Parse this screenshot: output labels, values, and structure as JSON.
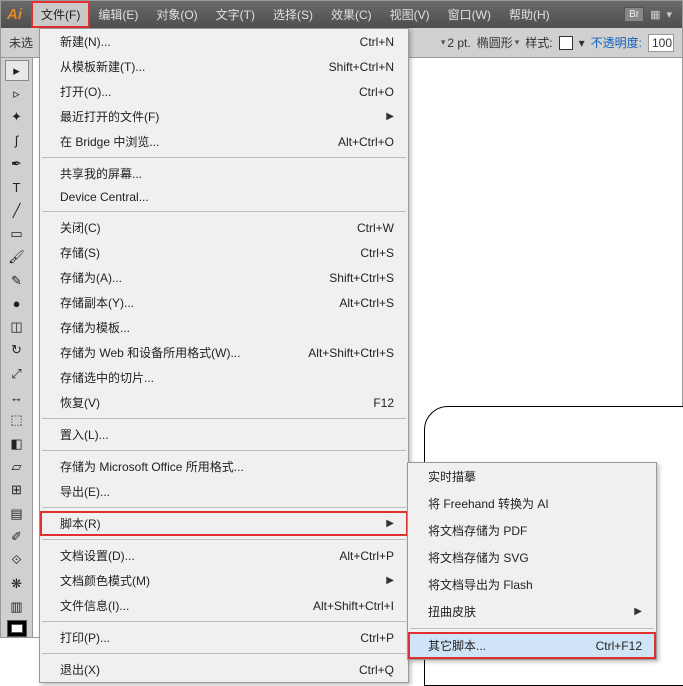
{
  "app": {
    "logo": "Ai"
  },
  "menubar": {
    "items": [
      {
        "label": "文件(F)",
        "active": true
      },
      {
        "label": "编辑(E)"
      },
      {
        "label": "对象(O)"
      },
      {
        "label": "文字(T)"
      },
      {
        "label": "选择(S)"
      },
      {
        "label": "效果(C)"
      },
      {
        "label": "视图(V)"
      },
      {
        "label": "窗口(W)"
      },
      {
        "label": "帮助(H)"
      }
    ]
  },
  "topright": {
    "br_label": "Br",
    "grid_icon": "▦",
    "down_icon": "▾"
  },
  "toolbar": {
    "prefix": "未选",
    "stroke_value": "2 pt.",
    "brush_name": "椭圆形",
    "style_label": "样式:",
    "opacity_label": "不透明度:",
    "opacity_value": "100"
  },
  "tools": [
    {
      "name": "selection-tool",
      "glyph": "▸"
    },
    {
      "name": "direct-select-tool",
      "glyph": "▹"
    },
    {
      "name": "magic-wand-tool",
      "glyph": "✦"
    },
    {
      "name": "lasso-tool",
      "glyph": "ʃ"
    },
    {
      "name": "pen-tool",
      "glyph": "✒"
    },
    {
      "name": "type-tool",
      "glyph": "T"
    },
    {
      "name": "line-tool",
      "glyph": "╱"
    },
    {
      "name": "rectangle-tool",
      "glyph": "▭"
    },
    {
      "name": "paintbrush-tool",
      "glyph": "🖌"
    },
    {
      "name": "pencil-tool",
      "glyph": "✎"
    },
    {
      "name": "blob-brush-tool",
      "glyph": "●"
    },
    {
      "name": "eraser-tool",
      "glyph": "◫"
    },
    {
      "name": "rotate-tool",
      "glyph": "↻"
    },
    {
      "name": "scale-tool",
      "glyph": "⤢"
    },
    {
      "name": "width-tool",
      "glyph": "↔"
    },
    {
      "name": "free-transform-tool",
      "glyph": "⬚"
    },
    {
      "name": "shape-builder-tool",
      "glyph": "◧"
    },
    {
      "name": "perspective-tool",
      "glyph": "▱"
    },
    {
      "name": "mesh-tool",
      "glyph": "⊞"
    },
    {
      "name": "gradient-tool",
      "glyph": "▤"
    },
    {
      "name": "eyedropper-tool",
      "glyph": "✐"
    },
    {
      "name": "blend-tool",
      "glyph": "⟐"
    },
    {
      "name": "symbol-sprayer-tool",
      "glyph": "❋"
    },
    {
      "name": "column-graph-tool",
      "glyph": "▥"
    }
  ],
  "file_menu": [
    {
      "type": "item",
      "label": "新建(N)...",
      "shortcut": "Ctrl+N"
    },
    {
      "type": "item",
      "label": "从模板新建(T)...",
      "shortcut": "Shift+Ctrl+N"
    },
    {
      "type": "item",
      "label": "打开(O)...",
      "shortcut": "Ctrl+O"
    },
    {
      "type": "item",
      "label": "最近打开的文件(F)",
      "arrow": true
    },
    {
      "type": "item",
      "label": "在 Bridge 中浏览...",
      "shortcut": "Alt+Ctrl+O"
    },
    {
      "type": "sep"
    },
    {
      "type": "item",
      "label": "共享我的屏幕..."
    },
    {
      "type": "item",
      "label": "Device Central..."
    },
    {
      "type": "sep"
    },
    {
      "type": "item",
      "label": "关闭(C)",
      "shortcut": "Ctrl+W"
    },
    {
      "type": "item",
      "label": "存储(S)",
      "shortcut": "Ctrl+S"
    },
    {
      "type": "item",
      "label": "存储为(A)...",
      "shortcut": "Shift+Ctrl+S"
    },
    {
      "type": "item",
      "label": "存储副本(Y)...",
      "shortcut": "Alt+Ctrl+S"
    },
    {
      "type": "item",
      "label": "存储为模板..."
    },
    {
      "type": "item",
      "label": "存储为 Web 和设备所用格式(W)...",
      "shortcut": "Alt+Shift+Ctrl+S"
    },
    {
      "type": "item",
      "label": "存储选中的切片..."
    },
    {
      "type": "item",
      "label": "恢复(V)",
      "shortcut": "F12"
    },
    {
      "type": "sep"
    },
    {
      "type": "item",
      "label": "置入(L)..."
    },
    {
      "type": "sep"
    },
    {
      "type": "item",
      "label": "存储为 Microsoft Office 所用格式..."
    },
    {
      "type": "item",
      "label": "导出(E)..."
    },
    {
      "type": "sep"
    },
    {
      "type": "item",
      "label": "脚本(R)",
      "arrow": true,
      "highlight": true
    },
    {
      "type": "sep"
    },
    {
      "type": "item",
      "label": "文档设置(D)...",
      "shortcut": "Alt+Ctrl+P"
    },
    {
      "type": "item",
      "label": "文档颜色模式(M)",
      "arrow": true
    },
    {
      "type": "item",
      "label": "文件信息(I)...",
      "shortcut": "Alt+Shift+Ctrl+I"
    },
    {
      "type": "sep"
    },
    {
      "type": "item",
      "label": "打印(P)...",
      "shortcut": "Ctrl+P"
    },
    {
      "type": "sep"
    },
    {
      "type": "item",
      "label": "退出(X)",
      "shortcut": "Ctrl+Q"
    }
  ],
  "script_submenu": [
    {
      "type": "item",
      "label": "实时描摹"
    },
    {
      "type": "item",
      "label": "将 Freehand 转换为 AI"
    },
    {
      "type": "item",
      "label": "将文档存储为 PDF"
    },
    {
      "type": "item",
      "label": "将文档存储为 SVG"
    },
    {
      "type": "item",
      "label": "将文档导出为 Flash"
    },
    {
      "type": "item",
      "label": "扭曲皮肤",
      "arrow": true
    },
    {
      "type": "sep"
    },
    {
      "type": "item",
      "label": "其它脚本...",
      "shortcut": "Ctrl+F12",
      "highlighted": true,
      "highlight_red": true
    }
  ]
}
